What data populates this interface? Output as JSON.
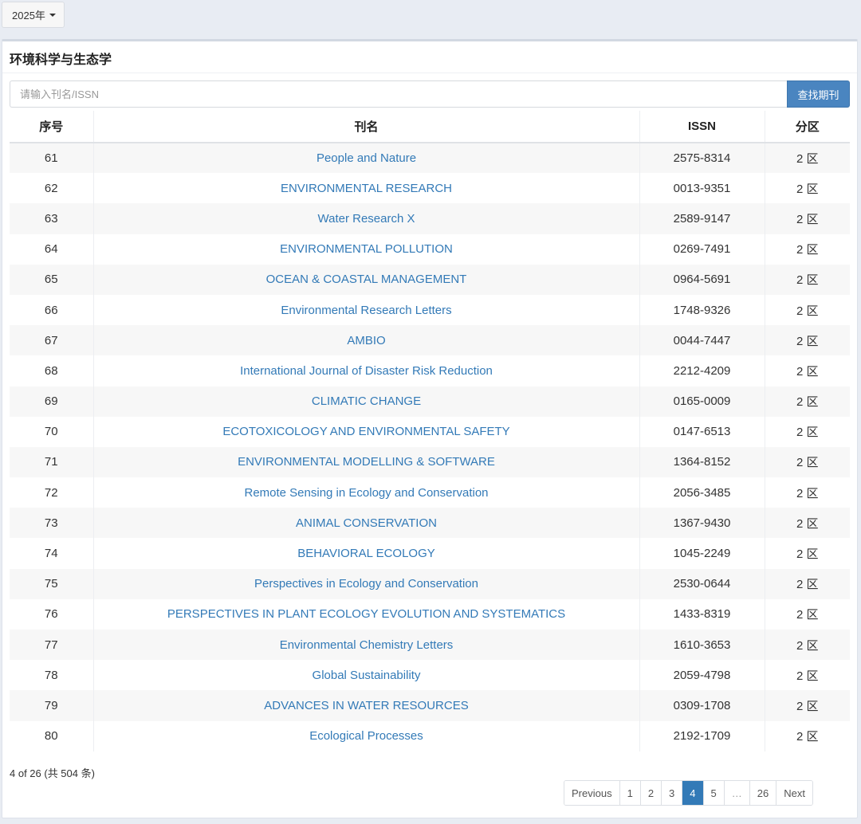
{
  "year_dropdown": {
    "label": "2025年"
  },
  "panel": {
    "title": "环境科学与生态学"
  },
  "search": {
    "placeholder": "请输入刊名/ISSN",
    "button_label": "查找期刊"
  },
  "table": {
    "headers": {
      "no": "序号",
      "name": "刊名",
      "issn": "ISSN",
      "zone": "分区"
    },
    "rows": [
      {
        "no": "61",
        "name": "People and Nature",
        "issn": "2575-8314",
        "zone": "2 区"
      },
      {
        "no": "62",
        "name": "ENVIRONMENTAL RESEARCH",
        "issn": "0013-9351",
        "zone": "2 区"
      },
      {
        "no": "63",
        "name": "Water Research X",
        "issn": "2589-9147",
        "zone": "2 区"
      },
      {
        "no": "64",
        "name": "ENVIRONMENTAL POLLUTION",
        "issn": "0269-7491",
        "zone": "2 区"
      },
      {
        "no": "65",
        "name": "OCEAN & COASTAL MANAGEMENT",
        "issn": "0964-5691",
        "zone": "2 区"
      },
      {
        "no": "66",
        "name": "Environmental Research Letters",
        "issn": "1748-9326",
        "zone": "2 区"
      },
      {
        "no": "67",
        "name": "AMBIO",
        "issn": "0044-7447",
        "zone": "2 区"
      },
      {
        "no": "68",
        "name": "International Journal of Disaster Risk Reduction",
        "issn": "2212-4209",
        "zone": "2 区"
      },
      {
        "no": "69",
        "name": "CLIMATIC CHANGE",
        "issn": "0165-0009",
        "zone": "2 区"
      },
      {
        "no": "70",
        "name": "ECOTOXICOLOGY AND ENVIRONMENTAL SAFETY",
        "issn": "0147-6513",
        "zone": "2 区"
      },
      {
        "no": "71",
        "name": "ENVIRONMENTAL MODELLING & SOFTWARE",
        "issn": "1364-8152",
        "zone": "2 区"
      },
      {
        "no": "72",
        "name": "Remote Sensing in Ecology and Conservation",
        "issn": "2056-3485",
        "zone": "2 区"
      },
      {
        "no": "73",
        "name": "ANIMAL CONSERVATION",
        "issn": "1367-9430",
        "zone": "2 区"
      },
      {
        "no": "74",
        "name": "BEHAVIORAL ECOLOGY",
        "issn": "1045-2249",
        "zone": "2 区"
      },
      {
        "no": "75",
        "name": "Perspectives in Ecology and Conservation",
        "issn": "2530-0644",
        "zone": "2 区"
      },
      {
        "no": "76",
        "name": "PERSPECTIVES IN PLANT ECOLOGY EVOLUTION AND SYSTEMATICS",
        "issn": "1433-8319",
        "zone": "2 区"
      },
      {
        "no": "77",
        "name": "Environmental Chemistry Letters",
        "issn": "1610-3653",
        "zone": "2 区"
      },
      {
        "no": "78",
        "name": "Global Sustainability",
        "issn": "2059-4798",
        "zone": "2 区"
      },
      {
        "no": "79",
        "name": "ADVANCES IN WATER RESOURCES",
        "issn": "0309-1708",
        "zone": "2 区"
      },
      {
        "no": "80",
        "name": "Ecological Processes",
        "issn": "2192-1709",
        "zone": "2 区"
      }
    ]
  },
  "pagination": {
    "info": "4 of 26 (共 504 条)",
    "items": [
      {
        "label": "Previous",
        "kind": "prev"
      },
      {
        "label": "1",
        "kind": "page"
      },
      {
        "label": "2",
        "kind": "page"
      },
      {
        "label": "3",
        "kind": "page"
      },
      {
        "label": "4",
        "kind": "page",
        "active": true
      },
      {
        "label": "5",
        "kind": "page"
      },
      {
        "label": "…",
        "kind": "ellipsis"
      },
      {
        "label": "26",
        "kind": "page"
      },
      {
        "label": "Next",
        "kind": "next"
      }
    ]
  },
  "colors": {
    "accent": "#337ab7",
    "button": "#4a85c0",
    "stripe": "#f7f7f7"
  }
}
